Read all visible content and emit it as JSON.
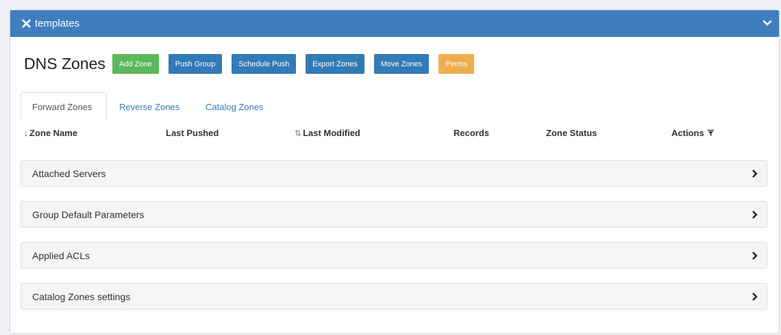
{
  "header": {
    "title": "templates",
    "close_icon": "x-icon",
    "collapse_icon": "chevron-down-icon"
  },
  "page": {
    "title": "DNS Zones"
  },
  "toolbar": {
    "add_zone": "Add Zone",
    "push_group": "Push Group",
    "schedule_push": "Schedule Push",
    "export_zones": "Export Zones",
    "move_zones": "Move Zones",
    "perms": "Perms"
  },
  "tabs": [
    "Forward Zones",
    "Reverse Zones",
    "Catalog Zones"
  ],
  "columns": {
    "zone_name": "Zone Name",
    "last_pushed": "Last Pushed",
    "last_modified": "Last Modified",
    "records": "Records",
    "zone_status": "Zone Status",
    "actions": "Actions"
  },
  "sections": [
    "Attached Servers",
    "Group Default Parameters",
    "Applied ACLs",
    "Catalog Zones settings"
  ],
  "colors": {
    "header": "#3f7ebd",
    "green": "#5cb85c",
    "blue": "#337ab7",
    "orange": "#f0ad4e"
  }
}
